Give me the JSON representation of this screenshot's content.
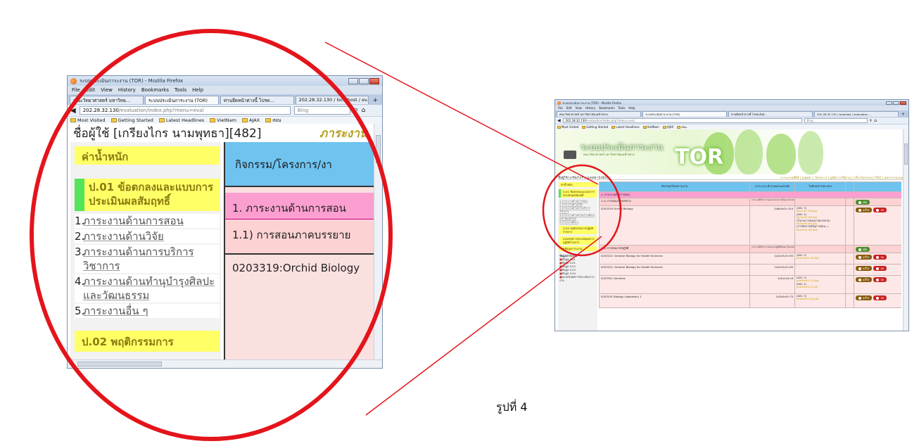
{
  "colors": {
    "callout_red": "#e4141b",
    "sidebar_yellow": "#ffff66",
    "table_header_blue": "#6ec3ef",
    "category_pink": "#fb9fd0",
    "subrow_pink": "#fcd2d2",
    "section_green": "#54e35a",
    "role_gold": "#b8a222"
  },
  "browser": {
    "title": "ระบบประเมินภาระงาน (TOR) - Mozilla Firefox",
    "menu": [
      "File",
      "Edit",
      "View",
      "History",
      "Bookmarks",
      "Tools",
      "Help"
    ],
    "tabs_zoom": [
      "คณะวิทยาศาสตร์ มหาวิทย...",
      "ระบบประเมินภาระงาน (TOR)",
      "ท่านยืดหน้าต่างนี้ โปรด...",
      "202.28.32.130 / localhost / ev..."
    ],
    "tabs_small": [
      "คณะวิทยาศาสตร์ มหาวิทยาลัยแม่ฟ้าหลวง",
      "ระบบประเมินภาระงาน (TOR)",
      "ท่านยืดหน้าต่างนี้ โปรดแจ้งค...",
      "202.28.32.130 / localhost / evaluation ..."
    ],
    "new_tab": "+",
    "url_host": "202.28.32.130",
    "url_path": "/evaluation/index.php?menu=eval",
    "search_placeholder": "Bing",
    "bookmarks": [
      "Most Visited",
      "Getting Started",
      "Latest Headlines",
      "VietNam",
      "AJAX",
      "สอน"
    ]
  },
  "zoom": {
    "user_line": "ชื่อผู้ใช้ [เกรียงไกร นามพุทธา][482]",
    "role": "ภาระงาน",
    "sidebar_header": "ค่าน้ำหนัก",
    "section1": "ป.01 ข้อตกลงและแบบการประเมินผลสัมฤทธิ์",
    "items": [
      {
        "num": "1.",
        "text": "ภาระงานด้านการสอน"
      },
      {
        "num": "2.",
        "text": "ภาระงานด้านวิจัย"
      },
      {
        "num": "3.",
        "text": "ภาระงานด้านการบริการวิชาการ"
      },
      {
        "num": "4.",
        "text": "ภาระงานด้านทำนุบำรุงศิลปะและวัฒนธรรม"
      },
      {
        "num": "5.",
        "text": "ภาระงานอื่น ๆ"
      }
    ],
    "section2": "ป.02 พฤติกรรมการ",
    "col_header": "กิจกรรม/โครงการ/งา",
    "row_category": "1. ภาระงานด้านการสอน",
    "row_sub": "1.1) การสอนภาคบรรยาย",
    "row_course": "0203319:Orchid Biology"
  },
  "small": {
    "banner_title": "ระบบประเมินภาระงาน",
    "banner_subtitle": "คณะวิทยาศาสตร์ มหาวิทยาลัยแม่ฟ้าหลวง",
    "banner_tor": "TOR",
    "user_line": "ชื่อผู้ใช้ [เกรียงไกร นามพุทธา][482]",
    "top_links": "ภาระงานปี44 | paper | โครงการ | คู่มือการใช้งาน | เกี่ยวกับระบบ | FAQ | ออกจากระบบ",
    "sidebar_header": "ค่าน้ำหนัก",
    "section1": "ป.01 ข้อตกลงและแบบการประเมินผลสัมฤทธิ์",
    "items": [
      "1.ภาระงานด้านการสอน",
      "2.ภาระงานด้านวิจัย",
      "3.ภาระงานด้านการบริการวิชาการ",
      "4.ภาระงานด้านทำนุบำรุงศิลปะและวัฒนธรรม",
      "5.ภาระงานอื่น ๆ"
    ],
    "section2": "ป.02 พฤติกรรมการปฏิบัติราชการ",
    "section3": "แบบสรุปการประเมินผลการปฏิบัติราชการ",
    "section4": "ดูข้อมูลภาระงาน",
    "stats_title": "ข้อมูลภาระงาน",
    "stats": [
      "ข้อมูล ป.01",
      "ข้อมูล ป.01",
      "ข้อมูล ป.02",
      "ข้อมูล ป.03",
      "ข้อมูล ป.04",
      "แบบสรุปผลการประเมินภาระงาน"
    ],
    "table_headers": [
      "กิจกรรม/โครงการ/งาน",
      "ภาระงาน (คำนวณตามเกณฑ์)",
      "ไฟล์เอกสารประกอบ",
      "",
      ""
    ],
    "row_category": "1. ภาระงานด้านการสอน",
    "row_sub1": "1.1) การสอนภาคบรรยาย",
    "row_sub1_note": "ภาระงานที่ได้จากการสอนภาคบรรยายทั้งหมด (ในเกณฑ์)",
    "course1": "0203319 Orchid Biology",
    "course1_load": "2x6x4x3=144",
    "course1_files": [
      {
        "k": "(ผลง. 3)",
        "f": "lecture1-65.jpg"
      },
      {
        "k": "(ผลง. 4)",
        "f": "lecture2-65.jpg"
      },
      {
        "k": "(ใบงานการสอนภาคบรรยาย)",
        "f": "lecture3-65.jpg"
      },
      {
        "k": "(การจัดการเรียนการสอน..)",
        "f": "lecture4-65.doc"
      }
    ],
    "row_sub2": "1.2) การสอนภาคปฏิบัติ",
    "row_sub2_note": "ภาระงานที่ได้จากการสอนภาคปฏิบัติทั้งหมด (ในเกณฑ์)",
    "courses": [
      {
        "name": "0203101 :General Biology for Health Sciences",
        "load": "1x2x15x3=90",
        "k": "(ผลง. 3)",
        "f": "practice1-10.doc"
      },
      {
        "name": "0203101 :General Biology for Health Sciences",
        "load": "1x2x15x3=90",
        "k": "",
        "f": ""
      },
      {
        "name": "0203341 Genetics",
        "load": "1x2x1x3=6",
        "k": "(ผลง. 3)",
        "f": "practice1-12.jpg"
      },
      {
        "name": "0203191 Biology Laboratory 1",
        "load": "1x3x5x5=75",
        "k": "(ผลง. 3)",
        "f": "practice1-29.pdf"
      }
    ],
    "course3_files": [
      {
        "k": "(ผลง. 3)",
        "f": "practice1-12.jpg"
      },
      {
        "k": "(ผลง. 4)",
        "f": "practice2-12.gif"
      }
    ],
    "btn_add": "เพิ่ม",
    "btn_edit": "แก้ไข",
    "btn_del": "ลบ"
  },
  "caption": "รูปที่ 4"
}
